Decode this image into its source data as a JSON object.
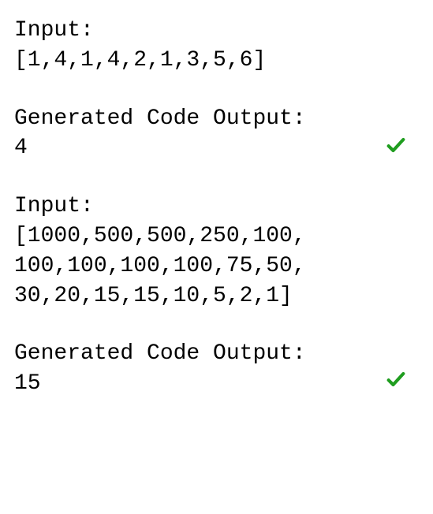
{
  "examples": [
    {
      "input_label": "Input:",
      "input_lines": [
        "[1,4,1,4,2,1,3,5,6]"
      ],
      "output_label": "Generated Code Output:",
      "output_value": "4",
      "correct": true
    },
    {
      "input_label": "Input:",
      "input_lines": [
        "[1000,500,500,250,100,",
        "100,100,100,100,75,50,",
        "30,20,15,15,10,5,2,1]"
      ],
      "output_label": "Generated Code Output:",
      "output_value": "15",
      "correct": true
    }
  ],
  "icons": {
    "checkmark": "check-icon"
  },
  "colors": {
    "check_green": "#1f9d1f"
  }
}
